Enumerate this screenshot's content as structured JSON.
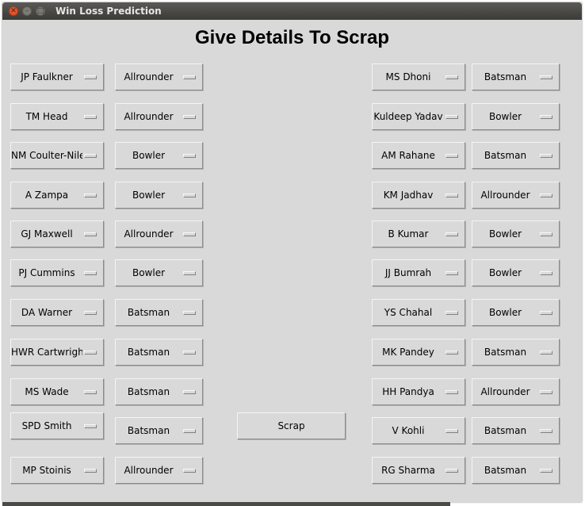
{
  "window": {
    "title": "Win Loss Prediction"
  },
  "heading": "Give Details To Scrap",
  "scrap_button": "Scrap",
  "team1": [
    {
      "player": "JP Faulkner",
      "role": "Allrounder"
    },
    {
      "player": "TM Head",
      "role": "Allrounder"
    },
    {
      "player": "NM Coulter-Nile",
      "role": "Bowler"
    },
    {
      "player": "A Zampa",
      "role": "Bowler"
    },
    {
      "player": "GJ Maxwell",
      "role": "Allrounder"
    },
    {
      "player": "PJ Cummins",
      "role": "Bowler"
    },
    {
      "player": "DA Warner",
      "role": "Batsman"
    },
    {
      "player": "HWR Cartwright",
      "role": "Batsman"
    },
    {
      "player": "MS Wade",
      "role": "Batsman"
    },
    {
      "player": "SPD Smith",
      "role": "Batsman"
    },
    {
      "player": "MP Stoinis",
      "role": "Allrounder"
    }
  ],
  "team2": [
    {
      "player": "MS Dhoni",
      "role": "Batsman"
    },
    {
      "player": "Kuldeep Yadav",
      "role": "Bowler"
    },
    {
      "player": "AM Rahane",
      "role": "Batsman"
    },
    {
      "player": "KM Jadhav",
      "role": "Allrounder"
    },
    {
      "player": "B Kumar",
      "role": "Bowler"
    },
    {
      "player": "JJ Bumrah",
      "role": "Bowler"
    },
    {
      "player": "YS Chahal",
      "role": "Bowler"
    },
    {
      "player": "MK Pandey",
      "role": "Batsman"
    },
    {
      "player": "HH Pandya",
      "role": "Allrounder"
    },
    {
      "player": "V Kohli",
      "role": "Batsman"
    },
    {
      "player": "RG Sharma",
      "role": "Batsman"
    }
  ]
}
